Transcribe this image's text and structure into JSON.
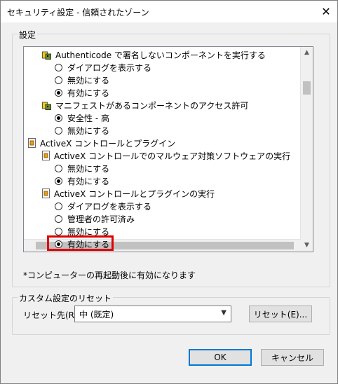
{
  "window": {
    "title": "セキュリティ設定 - 信頼されたゾーン"
  },
  "settings_group": {
    "label": "設定"
  },
  "tree": [
    {
      "kind": "security",
      "text": "Authenticode で署名しないコンポーネントを実行する"
    },
    {
      "kind": "radio",
      "text": "ダイアログを表示する",
      "checked": false
    },
    {
      "kind": "radio",
      "text": "無効にする",
      "checked": false
    },
    {
      "kind": "radio",
      "text": "有効にする",
      "checked": true
    },
    {
      "kind": "security",
      "text": "マニフェストがあるコンポーネントのアクセス許可"
    },
    {
      "kind": "radio",
      "text": "安全性 - 高",
      "checked": true
    },
    {
      "kind": "radio",
      "text": "無効にする",
      "checked": false
    },
    {
      "kind": "activex",
      "text": "ActiveX コントロールとプラグイン"
    },
    {
      "kind": "activex",
      "text": "ActiveX コントロールでのマルウェア対策ソフトウェアの実行"
    },
    {
      "kind": "radio",
      "text": "無効にする",
      "checked": false
    },
    {
      "kind": "radio",
      "text": "有効にする",
      "checked": true
    },
    {
      "kind": "activex",
      "text": "ActiveX コントロールとプラグインの実行"
    },
    {
      "kind": "radio",
      "text": "ダイアログを表示する",
      "checked": false
    },
    {
      "kind": "radio",
      "text": "管理者の許可済み",
      "checked": false
    },
    {
      "kind": "radio",
      "text": "無効にする",
      "checked": false
    },
    {
      "kind": "radio",
      "text": "有効にする",
      "checked": true
    }
  ],
  "note": "*コンピューターの再起動後に有効になります",
  "reset_group": {
    "label": "カスタム設定のリセット"
  },
  "reset_for_label": "リセット先(R):",
  "reset_select": {
    "value": "中 (既定)"
  },
  "buttons": {
    "reset": "リセット(E)...",
    "ok": "OK",
    "cancel": "キャンセル"
  },
  "colors": {
    "highlight": "#e00000",
    "default_button_border": "#0078d7"
  },
  "icons": {
    "close": "close-icon",
    "security_node": "shield-icon",
    "activex_node": "activex-icon"
  }
}
